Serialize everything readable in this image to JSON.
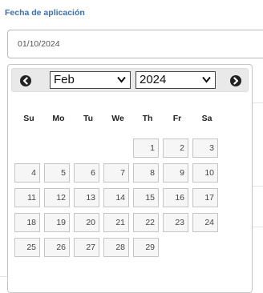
{
  "field": {
    "label": "Fecha de aplicación",
    "value": "01/10/2024"
  },
  "datepicker": {
    "prev_icon": "chevron-left-icon",
    "next_icon": "chevron-right-icon",
    "month_selected": "Feb",
    "year_selected": "2024",
    "weekdays": [
      "Su",
      "Mo",
      "Tu",
      "We",
      "Th",
      "Fr",
      "Sa"
    ],
    "first_weekday_index": 4,
    "days": [
      "1",
      "2",
      "3",
      "4",
      "5",
      "6",
      "7",
      "8",
      "9",
      "10",
      "11",
      "12",
      "13",
      "14",
      "15",
      "16",
      "17",
      "18",
      "19",
      "20",
      "21",
      "22",
      "23",
      "24",
      "25",
      "26",
      "27",
      "28",
      "29"
    ]
  }
}
